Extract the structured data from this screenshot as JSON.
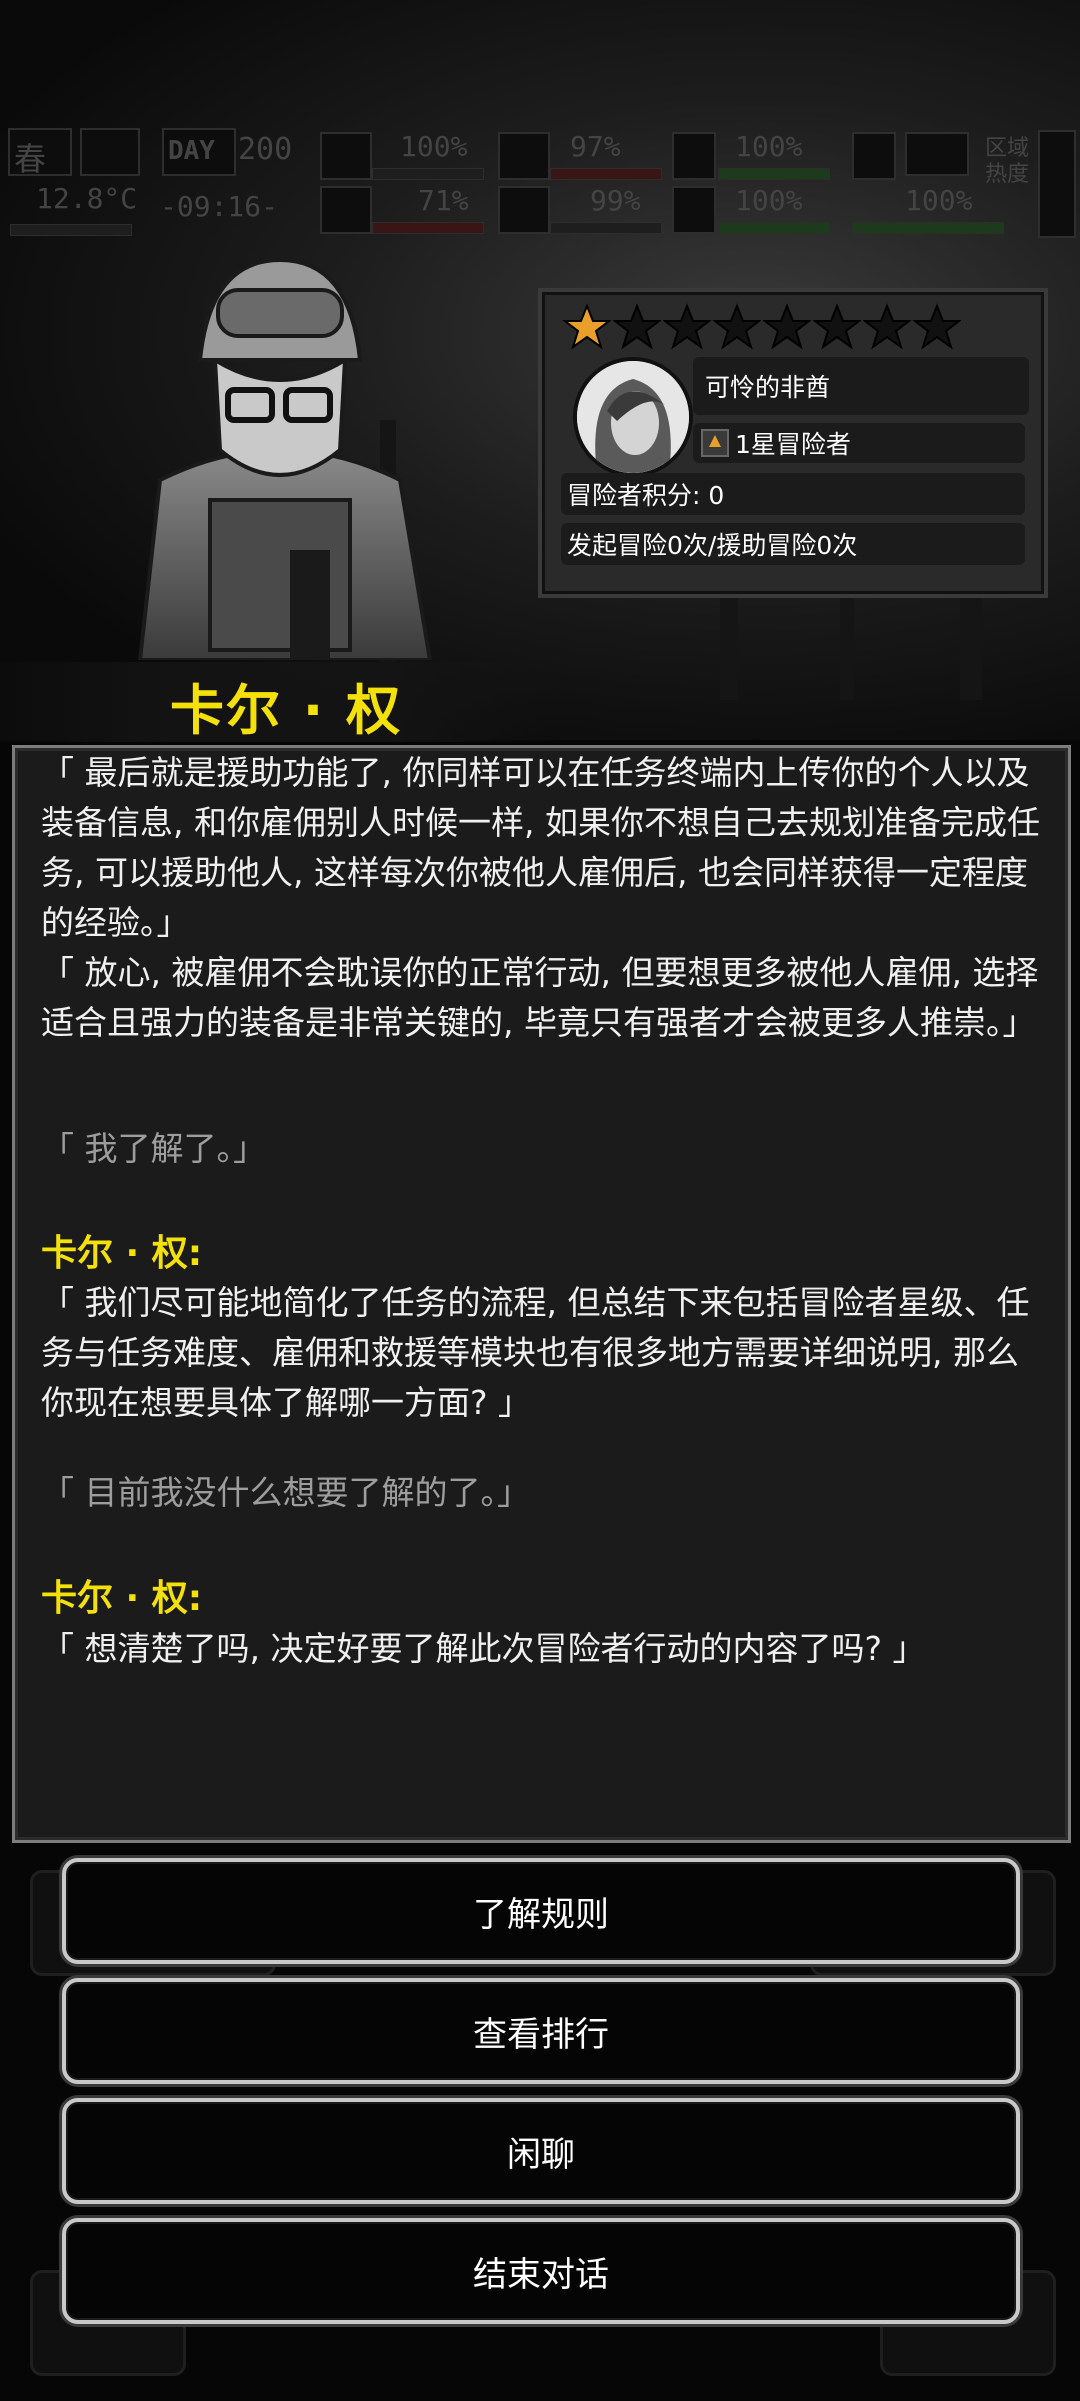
{
  "hud": {
    "season": "春",
    "day_label": "DAY",
    "day": "200",
    "temperature": "12.8°C",
    "time": "-09:16-",
    "stats_row1": [
      "100%",
      "97%",
      "100%"
    ],
    "stats_row2": [
      "71%",
      "99%",
      "100%",
      "100%"
    ],
    "region_label": "区域\n热度"
  },
  "profile": {
    "stars_filled": 1,
    "stars_total": 8,
    "name": "可怜的非酋",
    "rank": "1星冒险者",
    "score_label": "冒险者积分: 0",
    "adventures_label": "发起冒险0次/援助冒险0次"
  },
  "npc_name": "卡尔 · 权",
  "dialog": {
    "line1": "「 最后就是援助功能了, 你同样可以在任务终端内上传你的个人以及装备信息, 和你雇佣别人时候一样, 如果你不想自己去规划准备完成任务, 可以援助他人, 这样每次你被他人雇佣后, 也会同样获得一定程度的经验。」",
    "line2": "「 放心, 被雇佣不会耽误你的正常行动, 但要想更多被他人雇佣, 选择适合且强力的装备是非常关键的, 毕竟只有强者才会被更多人推崇。」",
    "reply1": "「 我了解了。」",
    "speaker1": "卡尔 · 权:",
    "line3": "「 我们尽可能地简化了任务的流程, 但总结下来包括冒险者星级、任务与任务难度、雇佣和救援等模块也有很多地方需要详细说明, 那么你现在想要具体了解哪一方面? 」",
    "reply2": "「 目前我没什么想要了解的了。」",
    "speaker2": "卡尔 · 权:",
    "line4": "「 想清楚了吗, 决定好要了解此次冒险者行动的内容了吗? 」"
  },
  "menu": {
    "option1": "了解规则",
    "option2": "查看排行",
    "option3": "闲聊",
    "option4": "结束对话"
  },
  "colors": {
    "accent_yellow": "#f5e10a",
    "star_gold": "#e8a02a"
  }
}
